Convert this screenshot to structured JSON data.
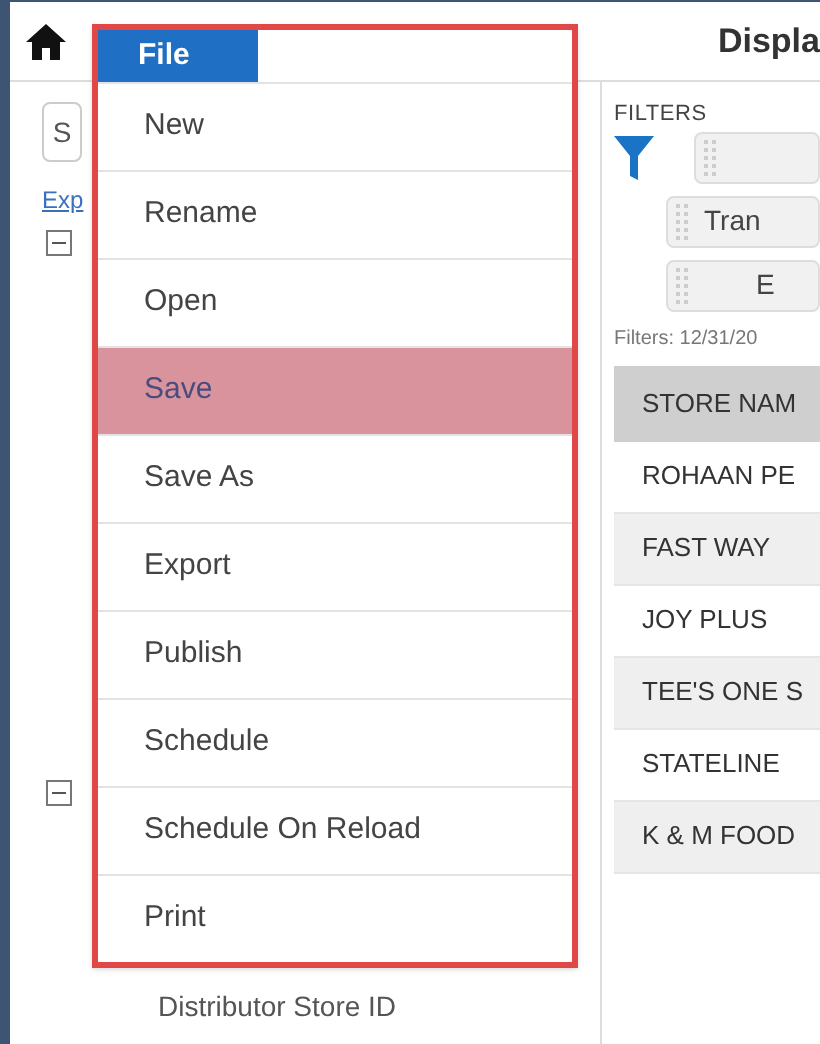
{
  "top_bar": {
    "title": "Displa"
  },
  "file_menu": {
    "label": "File",
    "items": [
      {
        "label": "New",
        "selected": false
      },
      {
        "label": "Rename",
        "selected": false
      },
      {
        "label": "Open",
        "selected": false
      },
      {
        "label": "Save",
        "selected": true
      },
      {
        "label": "Save As",
        "selected": false
      },
      {
        "label": "Export",
        "selected": false
      },
      {
        "label": "Publish",
        "selected": false
      },
      {
        "label": "Schedule",
        "selected": false
      },
      {
        "label": "Schedule On Reload",
        "selected": false
      },
      {
        "label": "Print",
        "selected": false
      }
    ]
  },
  "left_panel": {
    "search_value": "S",
    "link": "Exp",
    "fields": [
      "Distributor Store ID"
    ]
  },
  "filters": {
    "title": "FILTERS",
    "chips": [
      {
        "kind": "blank"
      },
      {
        "kind": "text",
        "label": "Tran"
      },
      {
        "kind": "text",
        "label": "E"
      }
    ],
    "summary": "Filters: 12/31/20"
  },
  "table": {
    "columns": [
      "STORE NAM"
    ],
    "rows": [
      "ROHAAN PE",
      "FAST WAY",
      "JOY PLUS",
      "TEE'S ONE S",
      "STATELINE",
      "K & M FOOD"
    ]
  }
}
